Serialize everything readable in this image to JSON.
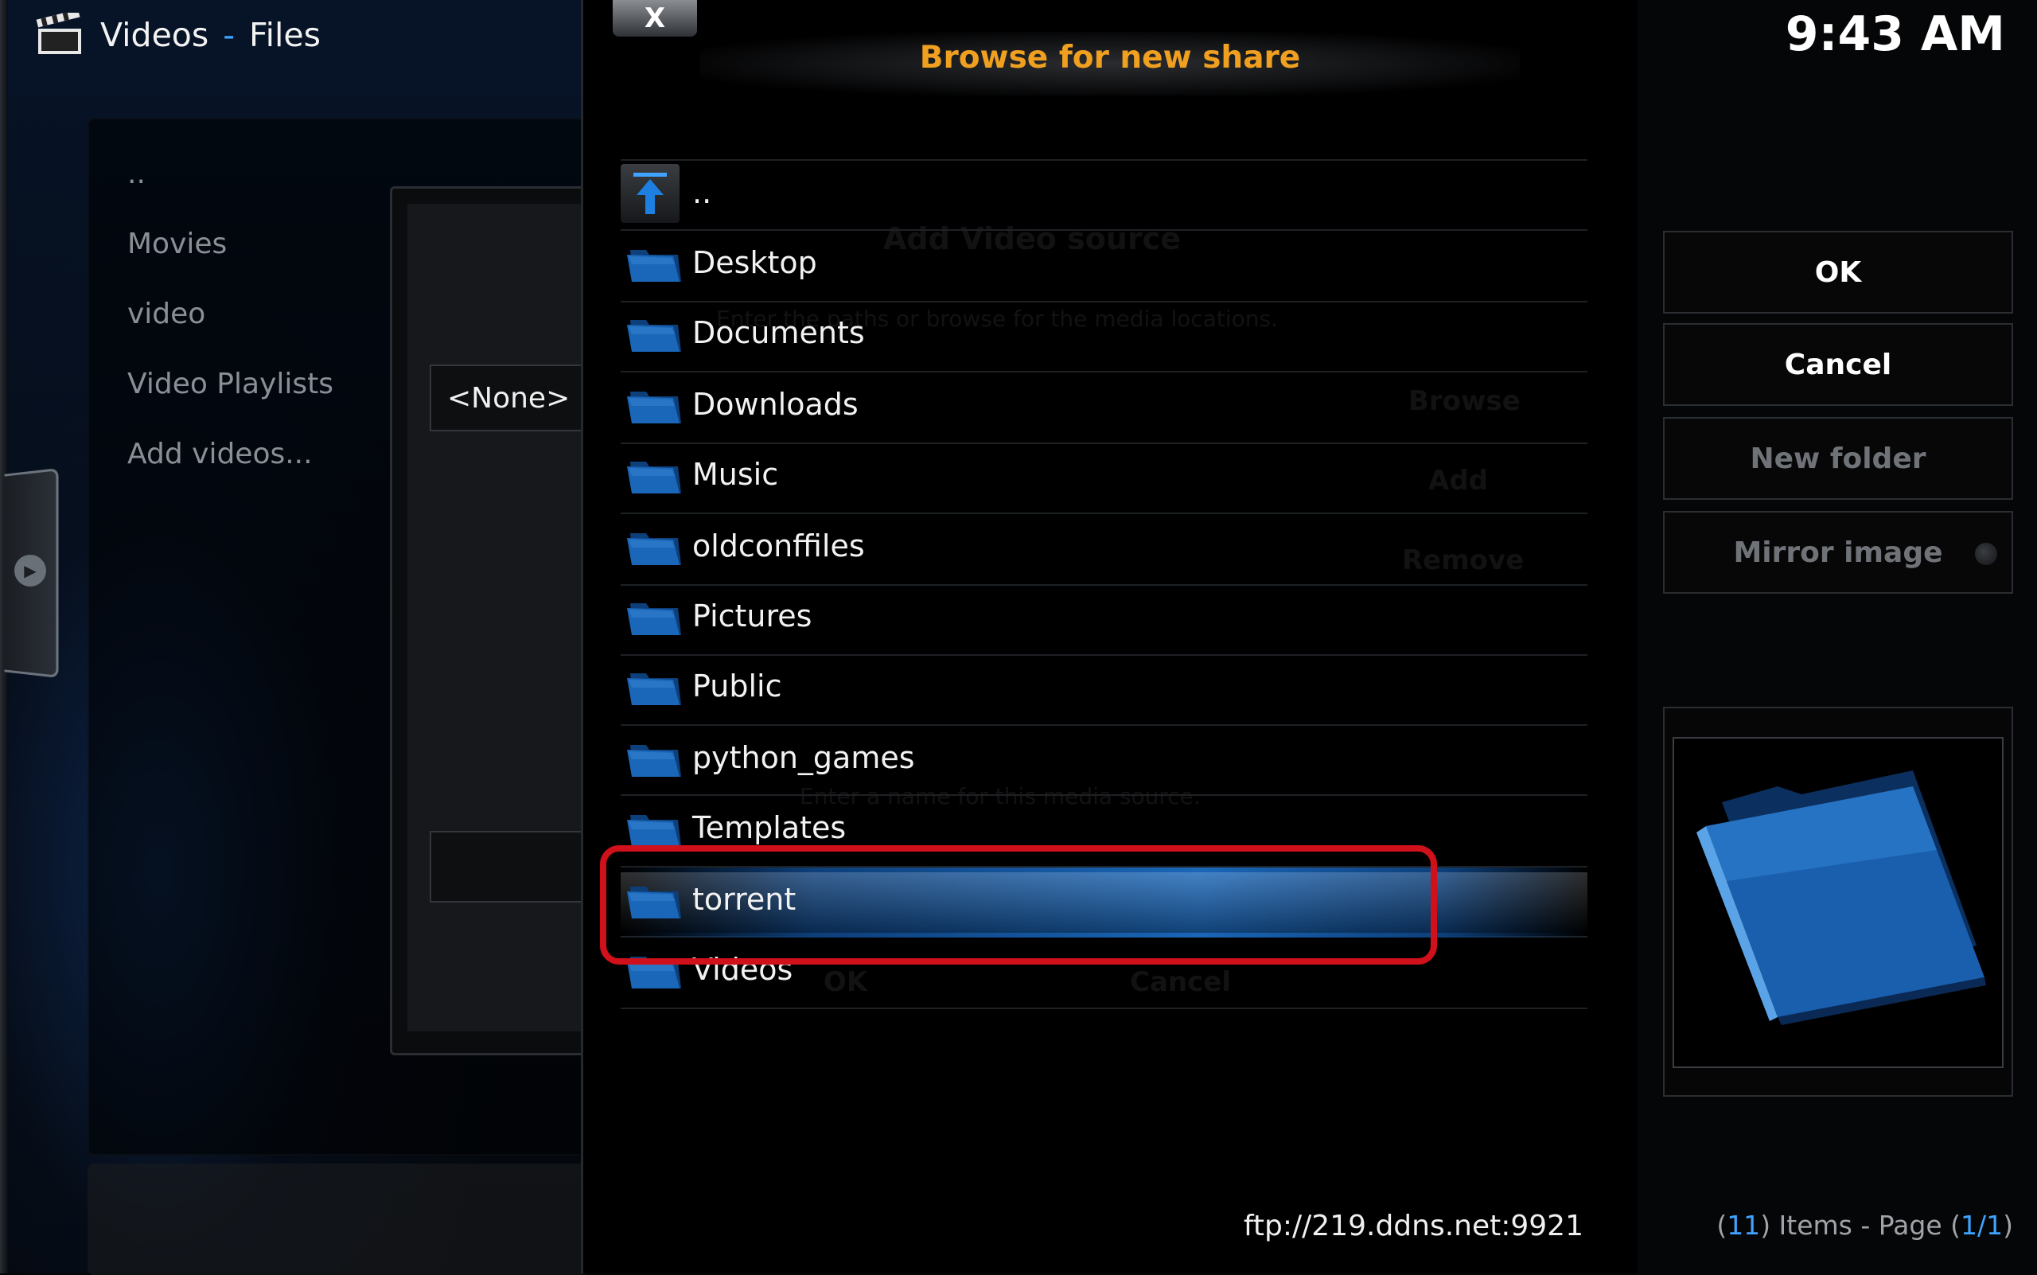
{
  "header": {
    "section": "Videos",
    "separator": "-",
    "subsection": "Files"
  },
  "clock": "9:43 AM",
  "sidebar": {
    "items": [
      {
        "label": ".."
      },
      {
        "label": "Movies"
      },
      {
        "label": "video"
      },
      {
        "label": "Video Playlists"
      },
      {
        "label": "Add videos..."
      }
    ]
  },
  "add_source_dialog": {
    "content_value": "<None>",
    "ghost_title": "Add Video source",
    "ghost_hint": "Enter the paths or browse for the media locations.",
    "ghost_browse": "Browse",
    "ghost_add": "Add",
    "ghost_remove": "Remove",
    "ghost_name_hint": "Enter a name for this media source.",
    "ghost_ok": "OK",
    "ghost_cancel": "Cancel"
  },
  "browse_dialog": {
    "title": "Browse for new share",
    "close_label": "X",
    "up_label": "..",
    "folders": [
      {
        "label": "Desktop"
      },
      {
        "label": "Documents"
      },
      {
        "label": "Downloads"
      },
      {
        "label": "Music"
      },
      {
        "label": "oldconffiles"
      },
      {
        "label": "Pictures"
      },
      {
        "label": "Public"
      },
      {
        "label": "python_games"
      },
      {
        "label": "Templates"
      },
      {
        "label": "torrent",
        "selected": true
      },
      {
        "label": "Videos"
      }
    ],
    "current_path": "ftp://219.ddns.net:9921"
  },
  "buttons": {
    "ok": "OK",
    "cancel": "Cancel",
    "new_folder": "New folder",
    "mirror_image": "Mirror image"
  },
  "footer": {
    "items_open": "(",
    "items_count": "11",
    "items_mid": ") Items - Page (",
    "page": "1/1",
    "items_close": ")"
  },
  "colors": {
    "accent": "#3fa3ff",
    "title": "#f0a020",
    "highlight": "#d0101a"
  }
}
